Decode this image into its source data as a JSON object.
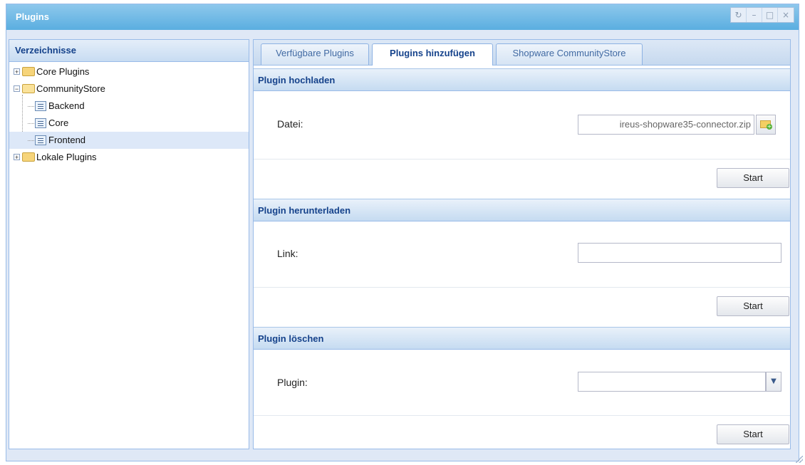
{
  "window": {
    "title": "Plugins",
    "controls": [
      "refresh-icon",
      "minimize-icon",
      "maximize-icon",
      "close-icon"
    ],
    "control_glyphs": {
      "refresh": "↻",
      "minimize": "–",
      "maximize": "□",
      "close": "×"
    }
  },
  "sidebar": {
    "title": "Verzeichnisse",
    "tree": [
      {
        "label": "Core Plugins",
        "expanded": false
      },
      {
        "label": "CommunityStore",
        "expanded": true,
        "children": [
          {
            "label": "Backend"
          },
          {
            "label": "Core"
          },
          {
            "label": "Frontend",
            "selected": true
          }
        ]
      },
      {
        "label": "Lokale Plugins",
        "expanded": false
      }
    ]
  },
  "tabs": [
    {
      "label": "Verfügbare Plugins",
      "active": false
    },
    {
      "label": "Plugins hinzufügen",
      "active": true
    },
    {
      "label": "Shopware CommunityStore",
      "active": false
    }
  ],
  "sections": {
    "upload": {
      "title": "Plugin hochladen",
      "field_label": "Datei:",
      "field_value": "ireus-shopware35-connector.zip",
      "button": "Start"
    },
    "download": {
      "title": "Plugin herunterladen",
      "field_label": "Link:",
      "field_value": "",
      "button": "Start"
    },
    "delete": {
      "title": "Plugin löschen",
      "field_label": "Plugin:",
      "field_value": "",
      "button": "Start"
    }
  },
  "colors": {
    "title_bar": "#5aaee0",
    "header_text": "#15428b",
    "panel_border": "#99bbe8"
  }
}
